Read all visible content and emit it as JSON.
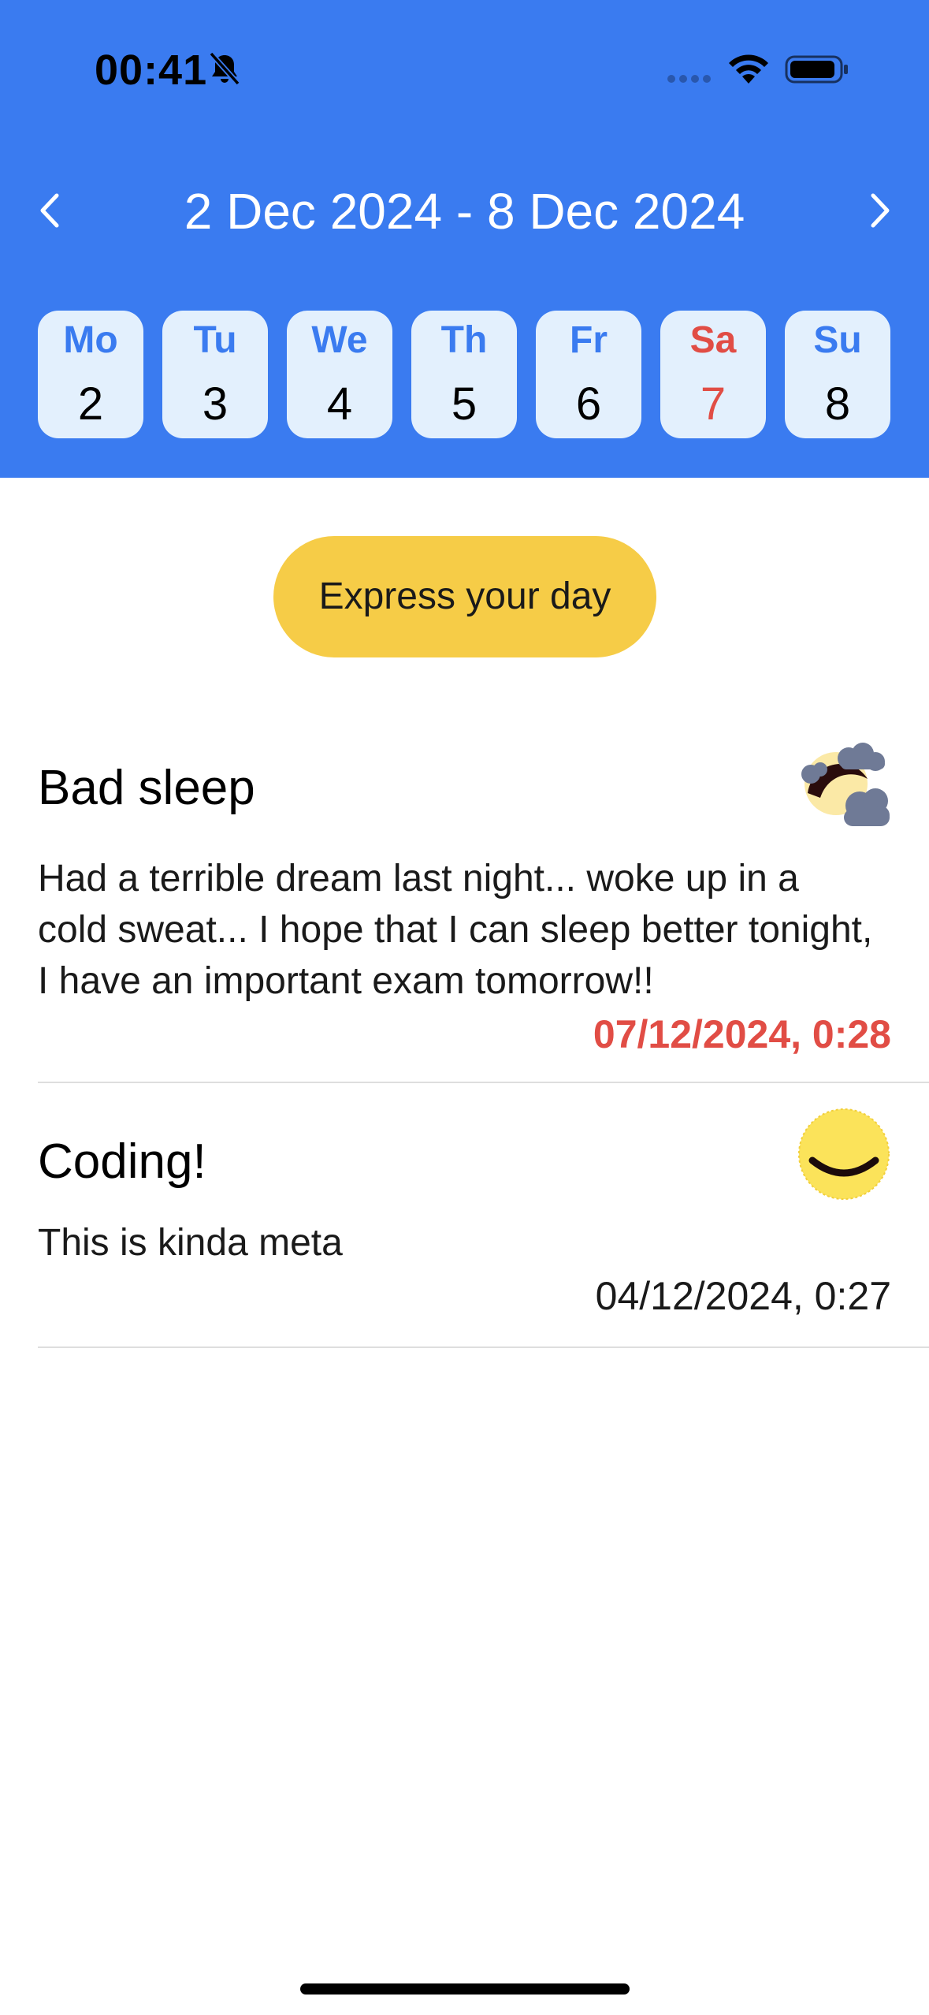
{
  "status_bar": {
    "time": "00:41",
    "icons": [
      "bell-slash-icon",
      "signal-dots-icon",
      "wifi-icon",
      "battery-icon"
    ]
  },
  "week_nav": {
    "range_label": "2 Dec 2024 - 8 Dec 2024",
    "prev_icon": "chevron-left-icon",
    "next_icon": "chevron-right-icon"
  },
  "days": [
    {
      "name": "Mo",
      "num": "2",
      "weekend": false
    },
    {
      "name": "Tu",
      "num": "3",
      "weekend": false
    },
    {
      "name": "We",
      "num": "4",
      "weekend": false
    },
    {
      "name": "Th",
      "num": "5",
      "weekend": false
    },
    {
      "name": "Fr",
      "num": "6",
      "weekend": false
    },
    {
      "name": "Sa",
      "num": "7",
      "weekend": true
    },
    {
      "name": "Su",
      "num": "8",
      "weekend": false
    }
  ],
  "express_button": {
    "label": "Express your day"
  },
  "entries": [
    {
      "title": "Bad sleep",
      "body": "Had a terrible dream last night... woke up in a cold sweat... I hope that I can sleep better tonight, I have an important exam tomorrow!!",
      "timestamp": "07/12/2024, 0:28",
      "mood_icon": "stormy-moon-icon",
      "highlight": true
    },
    {
      "title": "Coding!",
      "body": "This is kinda meta",
      "timestamp": "04/12/2024, 0:27",
      "mood_icon": "smiley-face-icon",
      "highlight": false
    }
  ],
  "colors": {
    "header_bg": "#3a7bf0",
    "day_card_bg": "#e3f0fd",
    "accent_blue": "#3a7bf0",
    "weekend_red": "#e14d45",
    "button_yellow": "#f6cc47"
  }
}
